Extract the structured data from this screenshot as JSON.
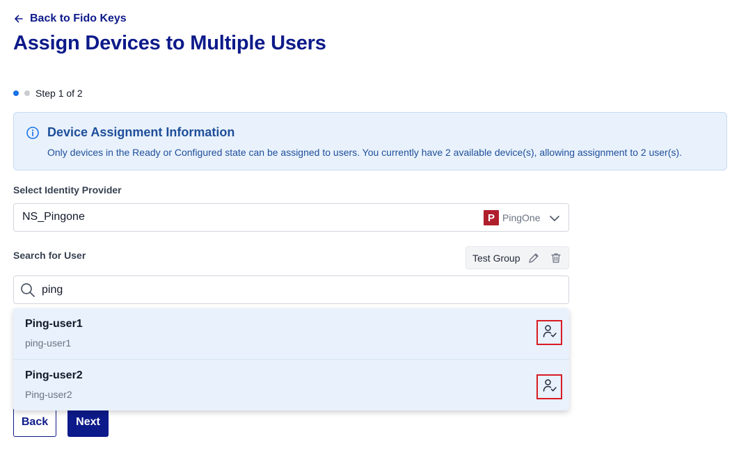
{
  "nav": {
    "back_label": "Back to Fido Keys",
    "back_icon": "arrow-left-icon"
  },
  "page": {
    "title": "Assign Devices to Multiple Users"
  },
  "stepper": {
    "text": "Step 1 of 2",
    "current": 1,
    "total": 2
  },
  "info": {
    "title": "Device Assignment Information",
    "text": "Only devices in the Ready or Configured state can be assigned to users. You currently have 2 available device(s), allowing assignment to 2 user(s).",
    "icon": "info-icon"
  },
  "provider": {
    "label": "Select Identity Provider",
    "value": "NS_Pingone",
    "provider_name": "PingOne",
    "logo_letter": "P"
  },
  "search": {
    "label": "Search for User",
    "value": "ping",
    "group_chip": "Test Group"
  },
  "results": [
    {
      "name": "Ping-user1",
      "username": "ping-user1"
    },
    {
      "name": "Ping-user2",
      "username": "Ping-user2"
    }
  ],
  "actions": {
    "back_label": "Back",
    "next_label": "Next"
  },
  "colors": {
    "brand": "#0d1a8a",
    "info_bg": "#e9f2fc",
    "info_text": "#1e4e9a",
    "highlight_red": "#d81b23",
    "ping_red": "#b01f2d",
    "step_active": "#1a73e8"
  }
}
